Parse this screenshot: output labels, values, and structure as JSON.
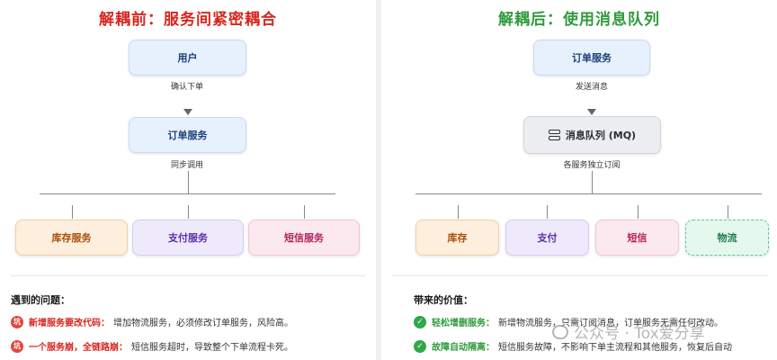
{
  "left": {
    "title": "解耦前：服务间紧密耦合",
    "user_box": "用户",
    "caption1": "确认下单",
    "order_box": "订单服务",
    "caption2": "同步调用",
    "services": [
      "库存服务",
      "支付服务",
      "短信服务"
    ],
    "problems_title": "遇到的问题：",
    "problems": [
      {
        "badge": "坑",
        "keyword": "新增服务要改代码：",
        "text": "增加物流服务，必须修改订单服务，风险高。"
      },
      {
        "badge": "坑",
        "keyword": "一个服务崩，全链路崩：",
        "text": "短信服务超时，导致整个下单流程卡死。"
      }
    ]
  },
  "right": {
    "title": "解耦后：使用消息队列",
    "order_box": "订单服务",
    "caption1": "发送消息",
    "mq_box": "消息队列 (MQ)",
    "caption2": "各服务独立订阅",
    "services": [
      "库存",
      "支付",
      "短信",
      "物流"
    ],
    "values_title": "带来的价值：",
    "values": [
      {
        "badge": "✓",
        "keyword": "轻松增删服务：",
        "text": "新增物流服务，只需订阅消息，订单服务无需任何改动。"
      },
      {
        "badge": "✓",
        "keyword": "故障自动隔离：",
        "text": "短信服务故障，不影响下单主流程和其他服务，恢复后自动"
      }
    ]
  },
  "watermark": "公众号 · Tox爱分享",
  "icons": {
    "mq": "database-stack-icon",
    "problem": "pit-badge-icon",
    "value": "check-circle-icon"
  },
  "colors": {
    "left_title": "#d7261e",
    "right_title": "#2e9b3c"
  }
}
